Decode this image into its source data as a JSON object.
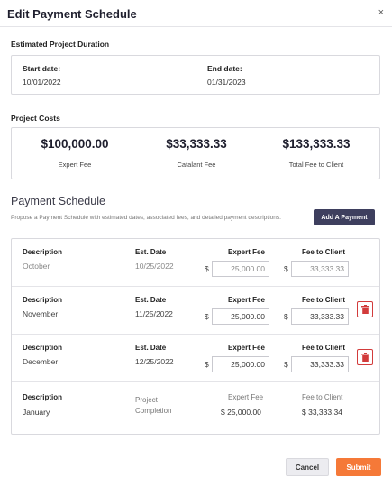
{
  "dialog": {
    "title": "Edit Payment Schedule",
    "close_icon": "×"
  },
  "duration": {
    "section_label": "Estimated Project Duration",
    "start_label": "Start date:",
    "start_value": "10/01/2022",
    "end_label": "End date:",
    "end_value": "01/31/2023"
  },
  "costs": {
    "section_label": "Project Costs",
    "items": [
      {
        "value": "$100,000.00",
        "label": "Expert Fee"
      },
      {
        "value": "$33,333.33",
        "label": "Catalant Fee"
      },
      {
        "value": "$133,333.33",
        "label": "Total Fee to Client"
      }
    ]
  },
  "schedule": {
    "title": "Payment Schedule",
    "description": "Propose a Payment Schedule with estimated dates, associated fees, and detailed payment descriptions.",
    "add_button": "Add A Payment",
    "headers": {
      "description": "Description",
      "date": "Est. Date",
      "expert_fee": "Expert Fee",
      "client_fee": "Fee to Client"
    },
    "currency_symbol": "$",
    "rows": [
      {
        "description": "October",
        "date": "10/25/2022",
        "expert_fee": "25,000.00",
        "client_fee": "33,333.33"
      },
      {
        "description": "November",
        "date": "11/25/2022",
        "expert_fee": "25,000.00",
        "client_fee": "33,333.33"
      },
      {
        "description": "December",
        "date": "12/25/2022",
        "expert_fee": "25,000.00",
        "client_fee": "33,333.33"
      }
    ],
    "final": {
      "description": "January",
      "date_line1": "Project",
      "date_line2": "Completion",
      "expert_fee": "$ 25,000.00",
      "client_fee": "$ 33,333.34"
    }
  },
  "footer": {
    "cancel_label": "Cancel",
    "submit_label": "Submit"
  },
  "colors": {
    "primary_dark": "#3e3f5e",
    "accent": "#f57938",
    "danger": "#d23b3b"
  }
}
